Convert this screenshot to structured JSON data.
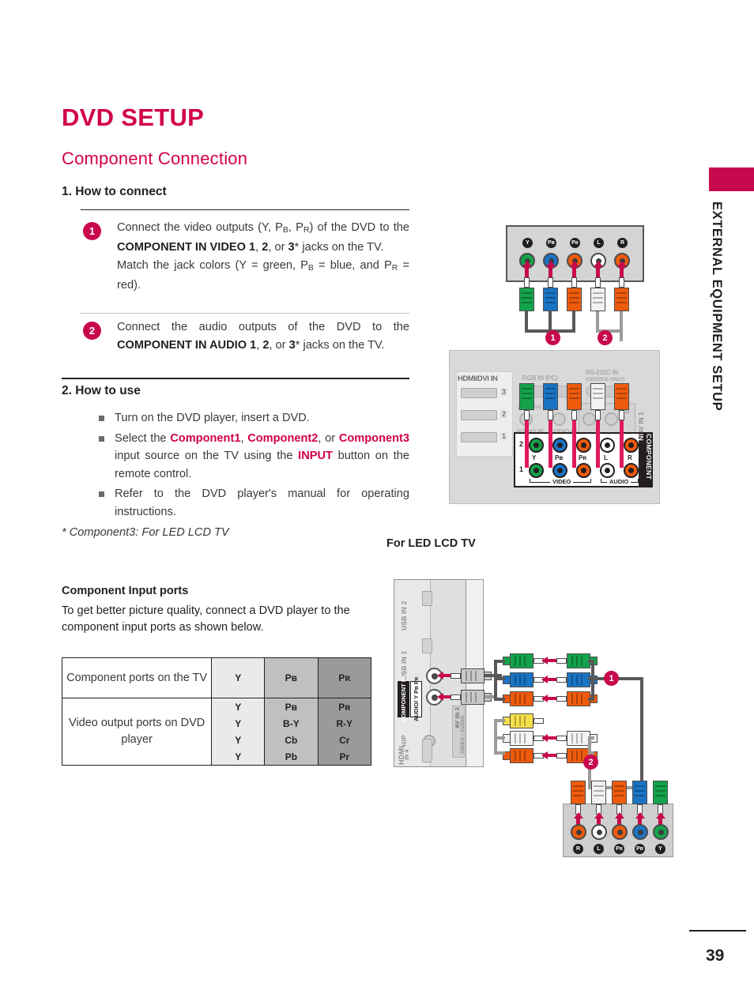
{
  "sidebar": {
    "tab_text": "EXTERNAL EQUIPMENT SETUP"
  },
  "headings": {
    "title": "DVD SETUP",
    "subtitle": "Component Connection",
    "section_1": "1. How to connect",
    "section_2": "2. How to use"
  },
  "steps": [
    {
      "number": "1",
      "html": "Connect the video outputs (Y, P<sub>B</sub>, P<sub>R</sub>)  of the DVD to the <b>COMPONENT IN VIDEO 1</b>, <b>2</b>, or <b>3</b>* jacks on the TV.<br>Match the jack colors (Y = green, P<sub>B</sub> = blue, and P<sub>R</sub> = red)."
    },
    {
      "number": "2",
      "html": "Connect the audio outputs of the DVD to the <b>COMPONENT IN AUDIO 1</b>, <b>2</b>, or <b>3</b>* jacks on the TV."
    }
  ],
  "bullets": [
    {
      "html": "Turn on the DVD player, insert a DVD."
    },
    {
      "html": "Select the <span class=\"pink\">Component1</span>, <span class=\"pink\">Component2</span>, or <span class=\"pink\">Component3</span> input source on the TV using the <span class=\"pink\">INPUT</span> button on the remote control."
    },
    {
      "html": "Refer to the DVD player's manual for operating instructions."
    }
  ],
  "footnote": "* Component3: For LED LCD TV",
  "component_input_ports": {
    "title": "Component Input ports",
    "description": "To get better picture quality, connect a DVD player to the component input ports as shown below."
  },
  "table": {
    "row1_label": "Component ports on the TV",
    "row1_values": [
      "Y",
      "Pʙ",
      "Pʀ"
    ],
    "row2_label": "Video output ports on DVD player",
    "row2_values": [
      [
        "Y",
        "Pʙ",
        "Pʀ"
      ],
      [
        "Y",
        "B-Y",
        "R-Y"
      ],
      [
        "Y",
        "Cb",
        "Cr"
      ],
      [
        "Y",
        "Pb",
        "Pr"
      ]
    ]
  },
  "diagram": {
    "led_caption": "For LED LCD TV",
    "dvd_top_jacks": [
      "Y",
      "Pʙ",
      "Pʀ",
      "L",
      "R"
    ],
    "dvd_bottom_jacks": [
      "R",
      "L",
      "Pʀ",
      "Pʙ",
      "Y"
    ],
    "tv_back": {
      "hdmi_title": "HDMI/DVI IN",
      "hdmi_numbers": [
        "3",
        "2",
        "1"
      ],
      "rgb_in": "RGB IN (PC)",
      "rs232": "RS-232C IN",
      "rs232_sub": "(SERVICE ONLY)",
      "rgb_audio": "(RGB/DVI)",
      "audio_in": "AUDIO IN",
      "audio_out": "AUDIO OUT",
      "av_in_1": "AV IN 1",
      "av_r": "R",
      "component_in": "COMPONENT IN",
      "row_numbers": [
        "2",
        "1"
      ],
      "jack_labels": [
        "Y",
        "Pʙ",
        "Pʀ",
        "L",
        "R"
      ],
      "group_video": "VIDEO",
      "group_audio": "AUDIO"
    },
    "side_panel": {
      "usb_in_2": "USB IN 2",
      "usb_in_1": "USB IN 1",
      "component_in": "COMPONENT IN",
      "component_audio": "AUDIO/ Y Pʙ Pʀ",
      "hp": "H/P",
      "hdmi": "HDMI",
      "hdmi_in4": "IN 4",
      "av_in_2": "AV IN 2",
      "av_in_2_sub": "VIDEO / AUDIO"
    },
    "callouts": [
      "1",
      "2"
    ]
  },
  "page_number": "39",
  "colors": {
    "brand_crimson": "#d1004b",
    "badge_crimson": "#c8084d",
    "green": "#14a34a",
    "blue": "#1a74c4",
    "orange": "#ef5b0c",
    "yellow": "#f5e04b",
    "table_light": "#eaeaea",
    "table_mid": "#c0c0c0",
    "table_dark": "#9a9a9a"
  }
}
